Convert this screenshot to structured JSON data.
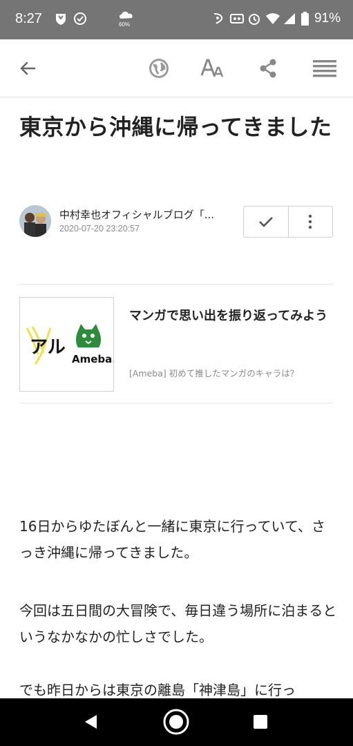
{
  "status_bar": {
    "time": "8:27",
    "weather_percent": "60%",
    "battery": "91%",
    "icons": [
      "shield-icon",
      "check-circle-icon",
      "weather-icon",
      "nfc-icon",
      "media-icon",
      "alarm-icon",
      "wifi-icon",
      "signal-icon",
      "battery-icon"
    ]
  },
  "app_bar": {
    "icons": [
      "back-arrow-icon",
      "globe-icon",
      "font-size-icon",
      "share-icon",
      "menu-icon"
    ]
  },
  "article": {
    "title": "東京から沖縄に帰ってきました",
    "author": "中村幸也オフィシャルブログ「...",
    "date": "2020-07-20 23:20:57"
  },
  "ad": {
    "title": "マンガで思い出を振り返ってみよう",
    "meta": "[Ameba]  初めて推したマンガのキャラは？",
    "logo_text": "Ameba.",
    "art_text": "アル"
  },
  "body": {
    "paragraphs": [
      "16日からゆたぼんと一緒に東京に行っていて、さっき沖縄に帰ってきました。",
      "今回は五日間の大冒険で、毎日違う場所に泊まるというなかなかの忙しさでした。",
      "でも昨日からは東京の離島「神津島」に行っ"
    ]
  },
  "colors": {
    "status_bar": "#757575",
    "ameba_green": "#2d8c3c",
    "text": "#222222",
    "meta": "#888888"
  }
}
